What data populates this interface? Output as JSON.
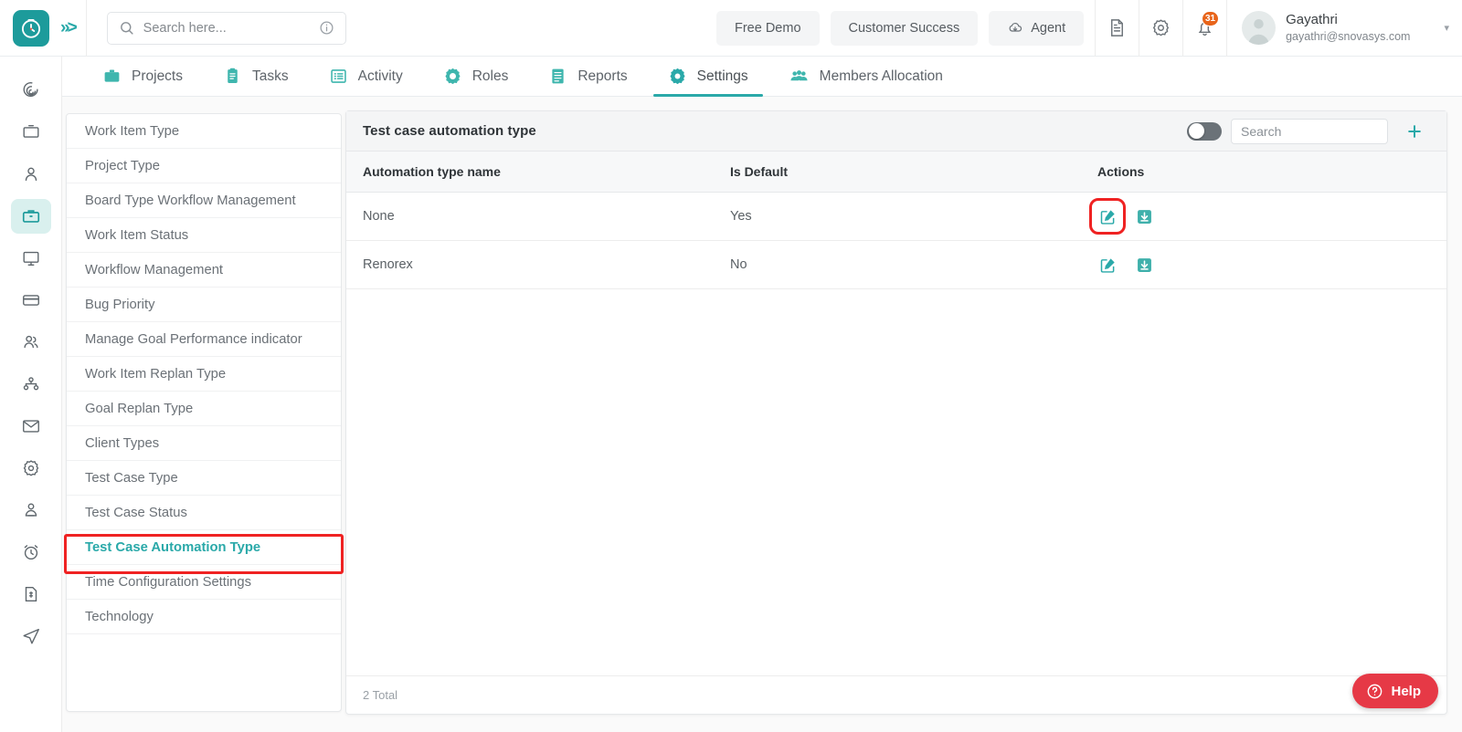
{
  "topbar": {
    "logo_icon": "clock-logo-icon",
    "expand_icon": "chevrons-right-icon",
    "search": {
      "placeholder": "Search here...",
      "value": "",
      "icon": "search-icon",
      "info_icon": "info-circle-icon"
    },
    "buttons": [
      {
        "label": "Free Demo",
        "name": "free-demo-button",
        "icon": ""
      },
      {
        "label": "Customer Success",
        "name": "customer-success-button",
        "icon": ""
      },
      {
        "label": "Agent",
        "name": "agent-button",
        "icon": "cloud-download-icon"
      }
    ],
    "icons": [
      {
        "name": "document-icon",
        "glyph": "document"
      },
      {
        "name": "gear-icon",
        "glyph": "gear"
      },
      {
        "name": "bell-icon",
        "glyph": "bell"
      }
    ],
    "notification_count": "31",
    "profile": {
      "name": "Gayathri",
      "email": "gayathri@snovasys.com",
      "caret": "▾"
    }
  },
  "nav": {
    "tabs": [
      {
        "label": "Projects",
        "icon": "briefcase-icon",
        "active": false
      },
      {
        "label": "Tasks",
        "icon": "clipboard-icon",
        "active": false
      },
      {
        "label": "Activity",
        "icon": "list-icon",
        "active": false
      },
      {
        "label": "Roles",
        "icon": "target-gear-icon",
        "active": false
      },
      {
        "label": "Reports",
        "icon": "report-icon",
        "active": false
      },
      {
        "label": "Settings",
        "icon": "gear-icon",
        "active": true
      },
      {
        "label": "Members Allocation",
        "icon": "people-group-icon",
        "active": false
      }
    ]
  },
  "rail": {
    "items": [
      {
        "name": "rail-item-dashboard",
        "icon": "spiral-icon",
        "active": false
      },
      {
        "name": "rail-item-board",
        "icon": "board-icon",
        "active": false
      },
      {
        "name": "rail-item-user",
        "icon": "user-icon",
        "active": false
      },
      {
        "name": "rail-item-projects",
        "icon": "briefcase-icon",
        "active": true
      },
      {
        "name": "rail-item-monitor",
        "icon": "monitor-icon",
        "active": false
      },
      {
        "name": "rail-item-billing",
        "icon": "card-icon",
        "active": false
      },
      {
        "name": "rail-item-team",
        "icon": "users-icon",
        "active": false
      },
      {
        "name": "rail-item-org",
        "icon": "org-chart-icon",
        "active": false
      },
      {
        "name": "rail-item-mail",
        "icon": "mail-icon",
        "active": false
      },
      {
        "name": "rail-item-settings",
        "icon": "gear-icon",
        "active": false
      },
      {
        "name": "rail-item-employee",
        "icon": "employee-icon",
        "active": false
      },
      {
        "name": "rail-item-timer",
        "icon": "alarm-clock-icon",
        "active": false
      },
      {
        "name": "rail-item-invoice",
        "icon": "invoice-icon",
        "active": false
      },
      {
        "name": "rail-item-send",
        "icon": "paper-plane-icon",
        "active": false
      }
    ]
  },
  "settings_menu": {
    "items": [
      {
        "label": "Work Item Type",
        "active": false
      },
      {
        "label": "Project Type",
        "active": false
      },
      {
        "label": "Board Type Workflow Management",
        "active": false
      },
      {
        "label": "Work Item Status",
        "active": false
      },
      {
        "label": "Workflow Management",
        "active": false
      },
      {
        "label": "Bug Priority",
        "active": false
      },
      {
        "label": "Manage Goal Performance indicator",
        "active": false
      },
      {
        "label": "Work Item Replan Type",
        "active": false
      },
      {
        "label": "Goal Replan Type",
        "active": false
      },
      {
        "label": "Client Types",
        "active": false
      },
      {
        "label": "Test Case Type",
        "active": false
      },
      {
        "label": "Test Case Status",
        "active": false
      },
      {
        "label": "Test Case Automation Type",
        "active": true
      },
      {
        "label": "Time Configuration Settings",
        "active": false
      },
      {
        "label": "Technology",
        "active": false
      }
    ]
  },
  "panel": {
    "title": "Test case automation type",
    "toggle_on": false,
    "search": {
      "placeholder": "Search",
      "value": ""
    },
    "add_label": "+",
    "columns": [
      "Automation type name",
      "Is Default",
      "Actions"
    ],
    "rows": [
      {
        "name": "None",
        "is_default": "Yes",
        "edit_icon": "edit-pencil-icon",
        "download_icon": "download-box-icon",
        "highlighted": true
      },
      {
        "name": "Renorex",
        "is_default": "No",
        "edit_icon": "edit-pencil-icon",
        "download_icon": "download-box-icon",
        "highlighted": false
      }
    ],
    "total": "2 Total"
  },
  "help": {
    "label": "Help",
    "icon": "question-circle-icon"
  },
  "colors": {
    "accent": "#2aa9a9",
    "logo_bg": "#1d9b9b",
    "highlight": "#ef2222",
    "badge": "#e8641a",
    "help": "#e63946"
  }
}
